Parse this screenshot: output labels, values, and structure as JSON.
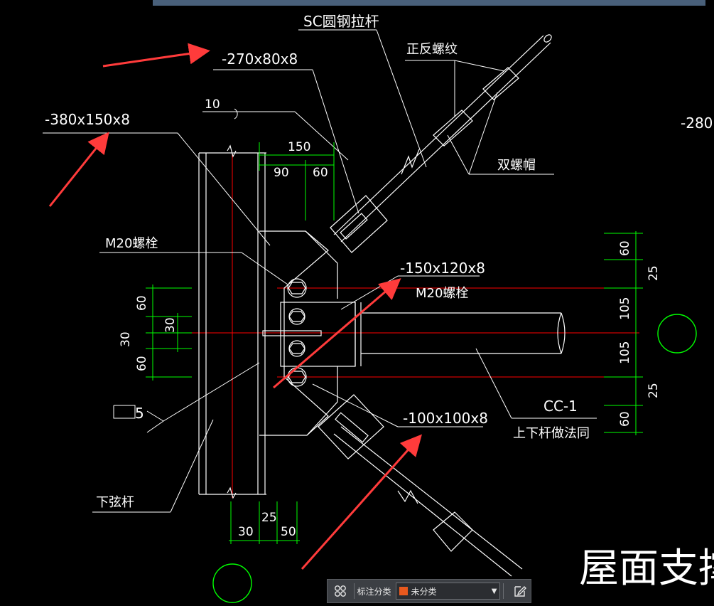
{
  "drawing": {
    "labels": {
      "sc_rod": "SC圆钢拉杆",
      "thread": "正反螺纹",
      "double_nut": "双螺帽",
      "plate_270": "-270x80x8",
      "plate_380": "-380x150x8",
      "plate_280": "-280",
      "weld_10": "10",
      "bolt_m20_left": "M20螺栓",
      "plate_150": "-150x120x8",
      "bolt_m20_right": "M20螺栓",
      "plate_100": "-100x100x8",
      "cc1": "CC-1",
      "same_method": "上下杆做法同",
      "weld_5": "5",
      "lower_chord": "下弦杆",
      "title_partial": "屋面支撑(S"
    },
    "dims": {
      "top_150": "150",
      "top_90": "90",
      "top_60": "60",
      "left_60a": "60",
      "left_30a": "30",
      "left_30b": "30",
      "left_60b": "60",
      "right_60a": "60",
      "right_25a": "25",
      "right_105a": "105",
      "right_105b": "105",
      "right_25b": "25",
      "right_60b": "60",
      "bottom_30": "30",
      "bottom_25": "25",
      "bottom_50": "50"
    },
    "colors": {
      "background": "#000000",
      "line": "#ffffff",
      "dimension": "#00ff00",
      "centerline": "#ff0000",
      "arrow": "#ff3b3b"
    }
  },
  "toolbar": {
    "category_label": "标注分类",
    "category_value": "未分类",
    "swatch_color": "#e8591e"
  }
}
